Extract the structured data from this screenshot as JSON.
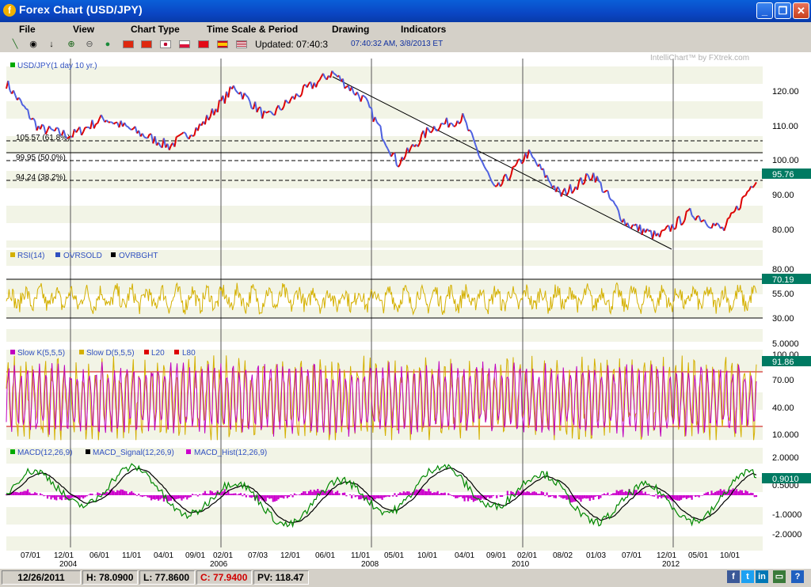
{
  "window": {
    "title": "Forex Chart (USD/JPY)",
    "app_icon": "fxtrek-logo",
    "min_glyph": "_",
    "max_glyph": "❐",
    "close_glyph": "✕"
  },
  "menu": [
    "File",
    "View",
    "Chart Type",
    "Time Scale & Period",
    "Drawing",
    "Indicators"
  ],
  "toolbar": {
    "updated_label": "Updated: 07:40:3",
    "timestamp": "07:40:32 AM, 3/8/2013 ET",
    "icons": [
      "trendline-icon",
      "target-icon",
      "arrow-down-icon",
      "zoom-in-icon",
      "zoom-out-icon",
      "globe-icon"
    ],
    "flags": [
      "china-flag",
      "hongkong-flag",
      "japan-flag",
      "poland-flag",
      "turkey-flag",
      "spain-flag",
      "usa-flag"
    ]
  },
  "watermark": "IntelliChart™ by FXtrek.com",
  "colors": {
    "price_up": "#dd0000",
    "price_down": "#4d5fe0",
    "rsi": "#d4b000",
    "stoch_k": "#d4b000",
    "stoch_d": "#c000c0",
    "macd_line": "#008800",
    "macd_signal": "#000000",
    "macd_hist": "#cc00cc",
    "value_tag": "#007a62",
    "band_line": "#cc0000"
  },
  "x_axis": {
    "ticks": [
      "07/01",
      "12/01",
      "06/01",
      "11/01",
      "04/01",
      "09/01",
      "02/01",
      "07/03",
      "12/01",
      "06/01",
      "11/01",
      "05/01",
      "10/01",
      "04/01",
      "09/01",
      "02/01",
      "08/02",
      "01/03",
      "07/01",
      "12/01",
      "05/01",
      "10/01"
    ],
    "years": [
      "2004",
      "2006",
      "2008",
      "2010",
      "2012"
    ]
  },
  "panels": {
    "price": {
      "legend": "USD/JPY(1 day  10 yr.)",
      "ticks": [
        "120.00",
        "110.00",
        "100.00",
        "90.00",
        "80.00"
      ],
      "fib_labels": [
        "105.57 (61.8%)",
        "99.95 (50.0%)",
        "94.24 (38.2%)"
      ],
      "current_tag": "95.76"
    },
    "rsi": {
      "legend": [
        "RSI(14)",
        "OVRSOLD",
        "OVRBGHT"
      ],
      "ticks": [
        "80.00",
        "55.00",
        "30.00",
        "5.0000"
      ],
      "current_tag": "70.19"
    },
    "stoch": {
      "legend": [
        "Slow K(5,5,5)",
        "Slow D(5,5,5)",
        "L20",
        "L80"
      ],
      "ticks": [
        "100.00",
        "70.00",
        "40.00",
        "10.000"
      ],
      "current_tag": "91.86"
    },
    "macd": {
      "legend": [
        "MACD(12,26,9)",
        "MACD_Signal(12,26,9)",
        "MACD_Hist(12,26,9)"
      ],
      "ticks": [
        "2.0000",
        "0.5000",
        "-1.0000",
        "-2.0000"
      ],
      "current_tag": "0.9010"
    }
  },
  "chart_data": {
    "type": "line",
    "title": "USD/JPY(1 day  10 yr.)",
    "period": "2003-2013",
    "ylim": [
      73,
      127
    ],
    "series": [
      {
        "name": "USD/JPY",
        "x": [
          "2003-05",
          "2004-01",
          "2004-03",
          "2004-06",
          "2004-10",
          "2005-01",
          "2005-06",
          "2005-12",
          "2006-05",
          "2006-11",
          "2007-06",
          "2007-09",
          "2008-03",
          "2008-06",
          "2008-08",
          "2008-12",
          "2009-04",
          "2009-11",
          "2010-05",
          "2011-03",
          "2011-10",
          "2012-02",
          "2012-09",
          "2013-02"
        ],
        "values": [
          120,
          107,
          105,
          110,
          106,
          102,
          108,
          119,
          110,
          117,
          123,
          115,
          97,
          107,
          110,
          89,
          100,
          88,
          94,
          80,
          76,
          83,
          78,
          93
        ]
      }
    ],
    "fib_levels": [
      105.57,
      99.95,
      94.24
    ],
    "latest": {
      "price": 95.76,
      "rsi": 70.19,
      "stoch_k": 91.86,
      "macd": 0.901
    }
  },
  "status": {
    "date": "12/26/2011",
    "high": "H: 78.0900",
    "low": "L: 77.8600",
    "close": "C: 77.9400",
    "pv": "PV: 118.47"
  },
  "social": [
    "facebook-icon",
    "twitter-icon",
    "linkedin-icon",
    "window-icon",
    "help-icon"
  ]
}
